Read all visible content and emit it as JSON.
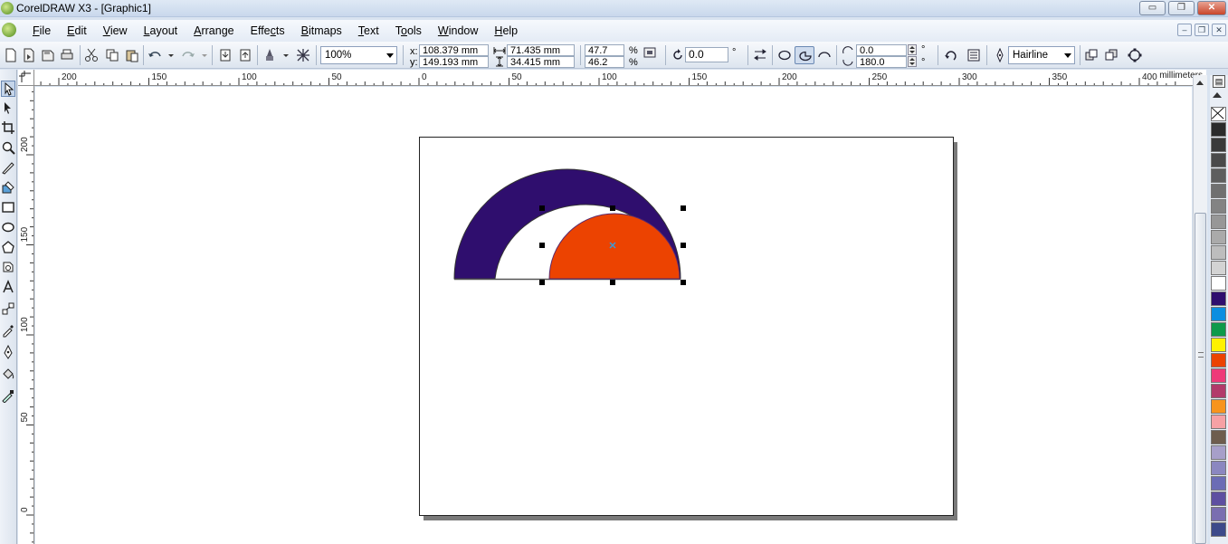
{
  "window": {
    "title": "CorelDRAW X3 - [Graphic1]",
    "buttons": {
      "minimize": "▭",
      "restore": "❐",
      "close": "✕"
    }
  },
  "menu": {
    "items": [
      {
        "key": "F",
        "rest": "ile"
      },
      {
        "key": "E",
        "rest": "dit"
      },
      {
        "key": "V",
        "rest": "iew"
      },
      {
        "key": "L",
        "rest": "ayout"
      },
      {
        "key": "A",
        "rest": "rrange"
      },
      {
        "key": "",
        "pre": "Effe",
        "key2": "c",
        "rest": "ts"
      },
      {
        "key": "B",
        "rest": "itmaps"
      },
      {
        "key": "T",
        "rest": "ext"
      },
      {
        "key": "",
        "pre": "T",
        "key2": "o",
        "rest": "ols"
      },
      {
        "key": "W",
        "rest": "indow"
      },
      {
        "key": "H",
        "rest": "elp"
      }
    ],
    "mdi_buttons": {
      "minimize": "–",
      "restore": "❐",
      "close": "✕"
    }
  },
  "toolbar": {
    "zoom": "100%",
    "x_label": "x:",
    "y_label": "y:",
    "x_value": "108.379 mm",
    "y_value": "149.193 mm",
    "width_value": "71.435 mm",
    "height_value": "34.415 mm",
    "scale_x": "47.7",
    "scale_y": "46.2",
    "percent": "%",
    "rotation": "0.0",
    "degree": "°",
    "start_angle": "0.0",
    "end_angle": "180.0",
    "outline_width": "Hairline"
  },
  "rulers": {
    "unit": "millimeters",
    "h_ticks": [
      "200",
      "150",
      "100",
      "50",
      "0",
      "50",
      "100",
      "150",
      "200",
      "250",
      "300",
      "350",
      "400"
    ],
    "v_ticks": [
      "200",
      "150",
      "100",
      "50",
      "0"
    ]
  },
  "palette": {
    "colors": [
      "#2b2b2b",
      "#3a3a3a",
      "#4a4a4a",
      "#5e5e5e",
      "#707070",
      "#838383",
      "#979797",
      "#aaaaaa",
      "#bdbdbd",
      "#d3d3d3",
      "#ffffff",
      "#2f0e6e",
      "#0b8ee0",
      "#0e9a4a",
      "#fff200",
      "#ec4301",
      "#ee3a79",
      "#b23a6a",
      "#f7941d",
      "#f6a1a4",
      "#6e5d4d",
      "#a79fc9",
      "#8b87c0",
      "#6b6cb5",
      "#5e4fa1",
      "#7a6eb0",
      "#3d4a8a"
    ]
  },
  "colors": {
    "outer_arc": "#2f0e6e",
    "inner_half_circle": "#ec4301",
    "center_marker": "#3a9ad9"
  }
}
